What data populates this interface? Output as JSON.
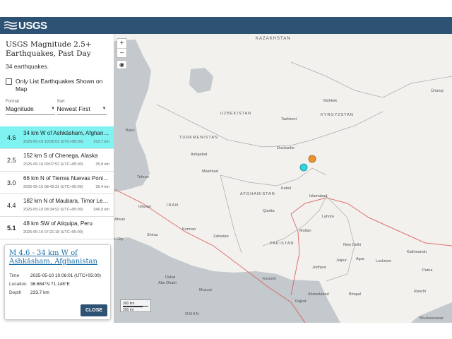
{
  "header": {
    "brand": "USGS"
  },
  "sidebar": {
    "title": "USGS Magnitude 2.5+ Earthquakes, Past Day",
    "count": "34 earthquakes.",
    "only_map_label": "Only List Earthquakes Shown on Map",
    "format_label": "Format",
    "format_value": "Magnitude",
    "sort_label": "Sort",
    "sort_value": "Newest First"
  },
  "earthquakes": [
    {
      "mag": "4.6",
      "place": "34 km W of Ashkāsham, Afghanistan",
      "time": "2025-05-10 10:08:01 (UTC+05:00)",
      "depth": "233.7 km",
      "selected": true
    },
    {
      "mag": "2.5",
      "place": "152 km S of Chenega, Alaska",
      "time": "2025-05-10 09:07:52 (UTC+05:00)",
      "depth": "35.8 km"
    },
    {
      "mag": "3.0",
      "place": "66 km N of Tierras Nuevas Poniente, Puerto Rico",
      "time": "2025-05-10 08:43:31 (UTC+05:00)",
      "depth": "30.4 km"
    },
    {
      "mag": "4.4",
      "place": "182 km N of Maubara, Timor Leste",
      "time": "2025-05-10 08:34:52 (UTC+05:00)",
      "depth": "546.5 km"
    },
    {
      "mag": "5.1",
      "place": "48 km SW of Atiquipa, Peru",
      "time": "2025-05-10 07:21:18 (UTC+05:00)",
      "depth": ""
    }
  ],
  "popup": {
    "title": "M 4.6 - 34 km W of Ashkāsham, Afghanistan",
    "time_label": "Time",
    "time_value": "2025-05-10 10:08:01 (UTC+05:00)",
    "location_label": "Location",
    "location_value": "36.664°N 71.148°E",
    "depth_label": "Depth",
    "depth_value": "233.7 km",
    "close_label": "CLOSE"
  },
  "map": {
    "zoom_in": "+",
    "zoom_out": "−",
    "scale_km": "300 km",
    "scale_mi": "200 mi",
    "labels": {
      "kazakhstan": "KAZAKHSTAN",
      "uzbekistan": "UZBEKISTAN",
      "turkmenistan": "TURKMENISTAN",
      "kyrgyzstan": "KYRGYZSTAN",
      "afghanistan": "AFGHANISTAN",
      "iran": "IRAN",
      "pakistan": "PAKISTAN",
      "oman": "OMAN",
      "tashkent": "Tashkent",
      "bishkek": "Bishkek",
      "urumqi": "Ürümqi",
      "dushanbe": "Dushanbe",
      "kabul": "Kabul",
      "islamabad": "Islamabad",
      "lahore": "Lahore",
      "ashgabat": "Ashgabat",
      "mashhad": "Mashhad",
      "tehran": "Tehran",
      "baku": "Baku",
      "isfahan": "Isfahan",
      "ahvaz": "Ahvaz",
      "shiraz": "Shiraz",
      "kerman": "Kerman",
      "zahedan": "Zahedan",
      "quetta": "Quetta",
      "multan": "Multan",
      "karachi": "Karachi",
      "new_delhi": "New Delhi",
      "jaipur": "Jaipur",
      "agra": "Agra",
      "lucknow": "Lucknow",
      "kathmandu": "Kathmandu",
      "jodhpur": "Jodhpur",
      "ahmedabad": "Ahmedabad",
      "bhopal": "Bhopal",
      "ranchi": "Ranchi",
      "rajkot": "Rajkot",
      "dubai": "Dubai",
      "abu_dhabi": "Abu Dhabi",
      "muscat": "Muscat",
      "bhubaneswar": "Bhubaneswar",
      "patna": "Patna",
      "kuwait_city": "t City"
    }
  },
  "colors": {
    "header": "#2d5273",
    "selected_row": "#7ff2f2",
    "marker_orange": "#f0922b",
    "marker_cyan": "#2fd5e0"
  }
}
